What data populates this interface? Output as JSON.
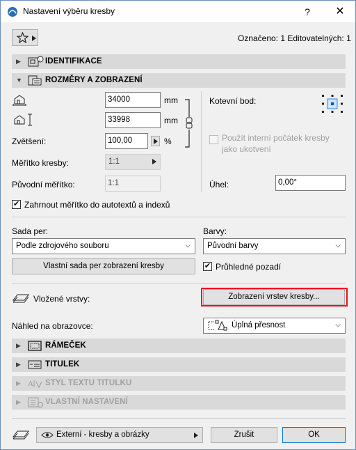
{
  "window": {
    "title": "Nastavení výběru kresby",
    "help_glyph": "?",
    "close_glyph": "✕"
  },
  "header": {
    "selection_info": "Označeno: 1 Editovatelných: 1"
  },
  "sections": {
    "identification": "IDENTIFIKACE",
    "size_display": "ROZMĚRY A ZOBRAZENÍ",
    "frame": "RÁMEČEK",
    "title": "TITULEK",
    "title_text_style": "STYL TEXTU TITULKU",
    "custom_settings": "VLASTNÍ NASTAVENÍ"
  },
  "size": {
    "width_value": "34000",
    "width_unit": "mm",
    "height_value": "33998",
    "height_unit": "mm",
    "zoom_label": "Zvětšení:",
    "zoom_value": "100,00",
    "zoom_unit": "%",
    "scale_label": "Měřítko kresby:",
    "scale_value": "1:1",
    "original_scale_label": "Původní měřítko:",
    "original_scale_value": "1:1",
    "anchor_label": "Kotevní bod:",
    "use_internal_origin": "Použít interní počátek kresby jako ukotvení",
    "use_internal_origin_checked": false,
    "angle_label": "Úhel:",
    "angle_value": "0,00°",
    "include_scale_label": "Zahrnout měřítko do autotextů a indexů",
    "include_scale_checked": true
  },
  "pens": {
    "pen_set_label": "Sada per:",
    "pen_set_value": "Podle zdrojového souboru",
    "colors_label": "Barvy:",
    "colors_value": "Původní barvy",
    "custom_pen_set_button": "Vlastní sada per zobrazení kresby",
    "transparent_bg_label": "Průhledné pozadí",
    "transparent_bg_checked": true
  },
  "layers": {
    "embedded_layers_label": "Vložené vrstvy:",
    "layer_display_button": "Zobrazení vrstev kresby..."
  },
  "preview": {
    "label": "Náhled na obrazovce:",
    "value": "Úplná přesnost"
  },
  "footer": {
    "layer_value": "Externí - kresby a obrázky",
    "cancel_label": "Zrušit",
    "ok_label": "OK"
  },
  "colors": {
    "highlight_border": "#e81123",
    "section_bg": "#d9d9d9",
    "dialog_bg": "#f0f0f0"
  }
}
